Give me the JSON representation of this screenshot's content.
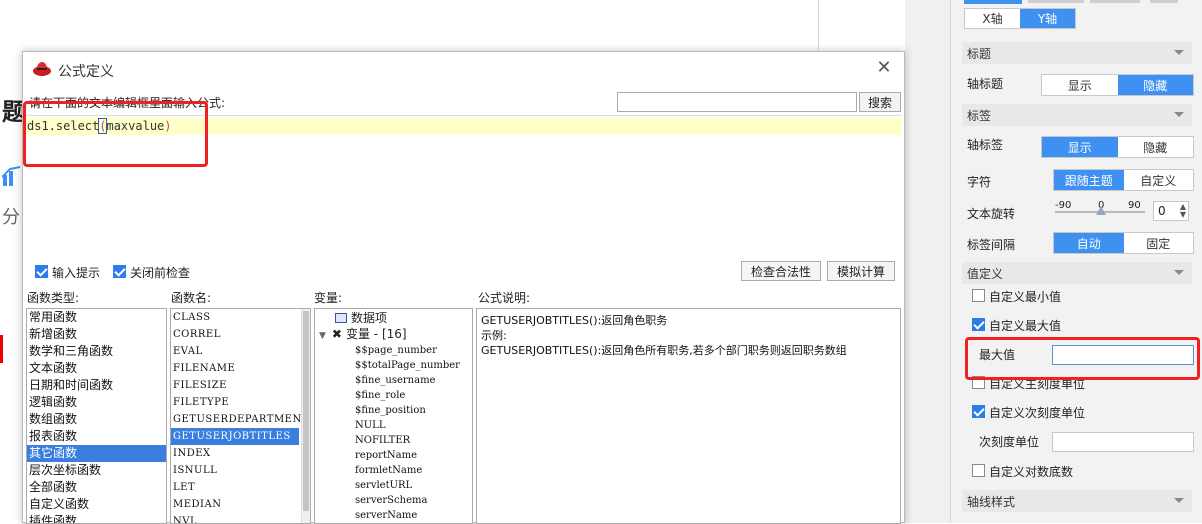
{
  "background": {
    "title_fragment": "题",
    "side_fragment": "分"
  },
  "right_panel": {
    "axis_tabs": [
      "X轴",
      "Y轴"
    ],
    "section_title": "标题",
    "axis_title_label": "轴标题",
    "axis_title_options": [
      "显示",
      "隐藏"
    ],
    "section_label": "标签",
    "axis_label_label": "轴标签",
    "axis_label_options": [
      "显示",
      "隐藏"
    ],
    "font_label": "字符",
    "font_options": [
      "跟随主题",
      "自定义"
    ],
    "rotation_label": "文本旋转",
    "rotation_ticks": [
      "-90",
      "0",
      "90"
    ],
    "rotation_value": "0",
    "interval_label": "标签间隔",
    "interval_options": [
      "自动",
      "固定"
    ],
    "value_section": "值定义",
    "custom_min_label": "自定义最小值",
    "custom_min_checked": false,
    "custom_max_label": "自定义最大值",
    "custom_max_checked": true,
    "max_value_label": "最大值",
    "max_value": "",
    "custom_major_label": "自定义主刻度单位",
    "custom_major_checked": false,
    "custom_minor_label": "自定义次刻度单位",
    "custom_minor_checked": true,
    "minor_unit_label": "次刻度单位",
    "minor_unit_value": "",
    "custom_log_label": "自定义对数底数",
    "custom_log_checked": false,
    "axis_style_section": "轴线样式",
    "accent_color": "#3e91f0"
  },
  "dialog": {
    "title": "公式定义",
    "prompt": "请在下面的文本编辑框里面输入公式:",
    "search_placeholder": "",
    "search_button": "搜索",
    "formula_prefix": "ds1.select",
    "formula_open": "(",
    "formula_arg": "maxvalue",
    "formula_close": ")",
    "input_hint_label": "输入提示",
    "input_hint_checked": true,
    "check_before_close_label": "关闭前检查",
    "check_before_close_checked": true,
    "check_validity_button": "检查合法性",
    "simulate_button": "模拟计算",
    "function_type_header": "函数类型:",
    "function_name_header": "函数名:",
    "variable_header": "变量:",
    "formula_desc_header": "公式说明:",
    "function_types": [
      "常用函数",
      "新增函数",
      "数学和三角函数",
      "文本函数",
      "日期和时间函数",
      "逻辑函数",
      "数组函数",
      "报表函数",
      "其它函数",
      "层次坐标函数",
      "全部函数",
      "自定义函数",
      "插件函数"
    ],
    "selected_function_type": "其它函数",
    "function_names": [
      "CLASS",
      "CORREL",
      "EVAL",
      "FILENAME",
      "FILESIZE",
      "FILETYPE",
      "GETUSERDEPARTMENTS",
      "GETUSERJOBTITLES",
      "INDEX",
      "ISNULL",
      "LET",
      "MEDIAN",
      "NVL"
    ],
    "selected_function_name": "GETUSERJOBTITLES",
    "variable_root": "数据项",
    "variable_group": "变量 - [16]",
    "variables": [
      "$$page_number",
      "$$totalPage_number",
      "$fine_username",
      "$fine_role",
      "$fine_position",
      "NULL",
      "NOFILTER",
      "reportName",
      "formletName",
      "servletURL",
      "serverSchema",
      "serverName"
    ],
    "desc_line1": "GETUSERJOBTITLES():返回角色职务",
    "desc_line2": "示例:",
    "desc_line3": "GETUSERJOBTITLES():返回角色所有职务,若多个部门职务则返回职务数组"
  }
}
